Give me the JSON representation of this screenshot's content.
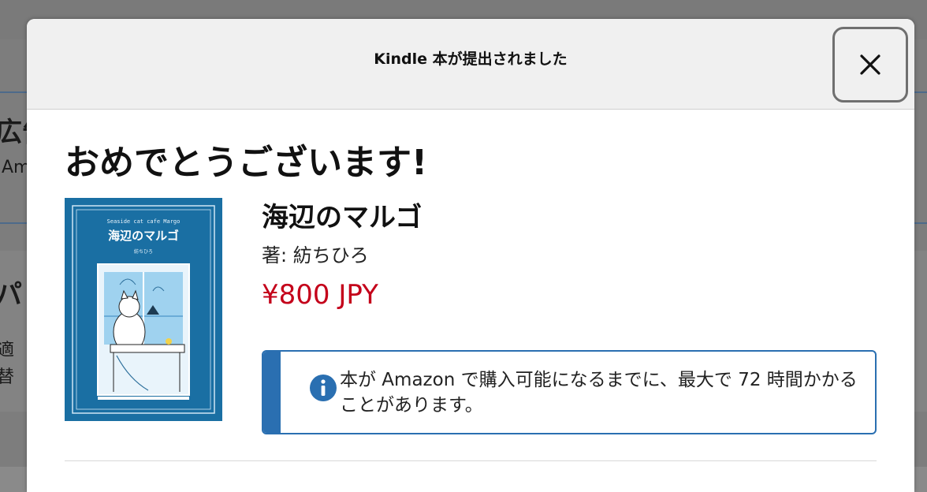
{
  "background": {
    "fragments": [
      "広告",
      "Am",
      "パ",
      "適",
      "替"
    ]
  },
  "modal": {
    "header_title": "Kindle 本が提出されました",
    "close_label": "×",
    "congrats": "おめでとうございます!",
    "book": {
      "title": "海辺のマルゴ",
      "author": "著: 紡ちひろ",
      "price": "¥800 JPY",
      "cover": {
        "subtitle": "Seaside cat cafe Margo",
        "title": "海辺のマルゴ",
        "author": "紡ちひろ"
      }
    },
    "info": {
      "icon": "info-icon",
      "text": "本が Amazon で購入可能になるまでに、最大で 72 時間かかることがあります。"
    }
  },
  "colors": {
    "price": "#c4001a",
    "info_accent": "#2a6fb1",
    "cover_blue": "#1a6fa3"
  }
}
